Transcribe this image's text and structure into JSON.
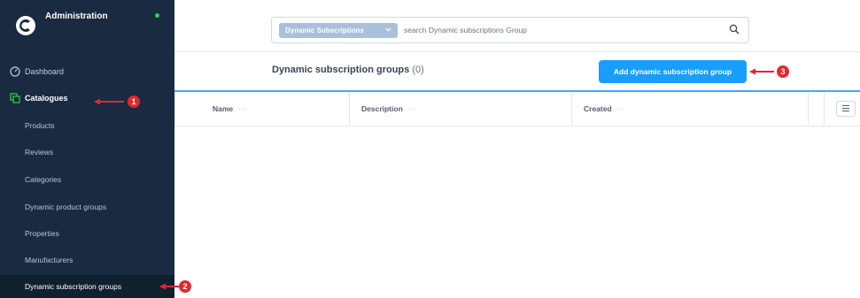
{
  "app": {
    "title": "Administration"
  },
  "sidebar": {
    "items": [
      {
        "label": "Dashboard",
        "icon": "dashboard-icon"
      },
      {
        "label": "Catalogues",
        "icon": "catalogues-icon"
      }
    ],
    "catalogue_sub_items": [
      "Products",
      "Reviews",
      "Categories",
      "Dynamic product groups",
      "Properties",
      "Manufacturers",
      "Dynamic subscription groups"
    ]
  },
  "search": {
    "entity_label": "Dynamic Subscriptions",
    "placeholder": "search Dynamic subscriptions Group"
  },
  "header": {
    "title": "Dynamic subscription groups",
    "count": "(0)",
    "add_button_label": "Add dynamic subscription group"
  },
  "table": {
    "columns": [
      "Name",
      "Description",
      "Created"
    ],
    "column_menu": "···"
  },
  "annotations": {
    "badge1": "1",
    "badge2": "2",
    "badge3": "3"
  },
  "colors": {
    "sidebar_bg": "#1a2a40",
    "accent": "#189eff",
    "annotation_red": "#e4272f",
    "status_green": "#37d046"
  }
}
